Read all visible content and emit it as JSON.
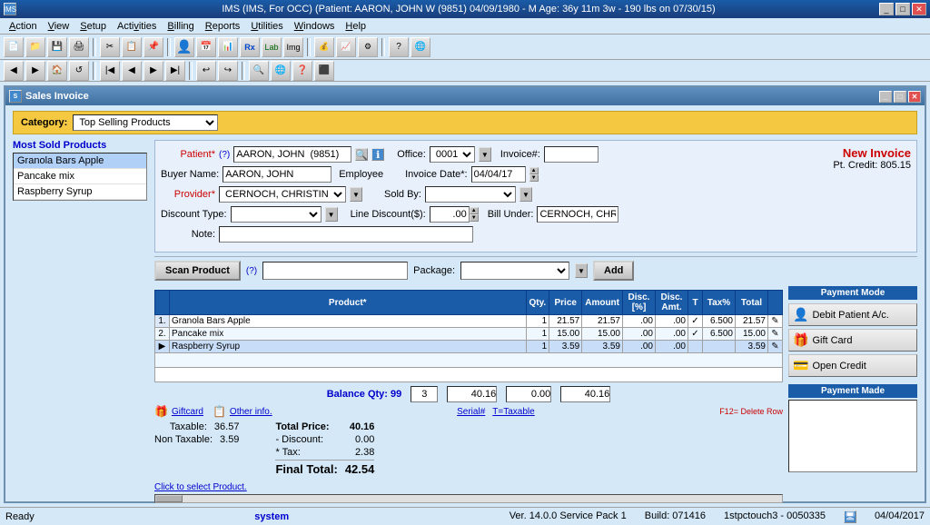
{
  "titlebar": {
    "text": "IMS (IMS, For OCC)    (Patient: AARON, JOHN W (9851) 04/09/1980 - M Age: 36y 11m 3w - 190 lbs on 07/30/15)"
  },
  "menubar": {
    "items": [
      "Action",
      "View",
      "Setup",
      "Activities",
      "Billing",
      "Reports",
      "Utilities",
      "Windows",
      "Help"
    ]
  },
  "window_title": "Sales Invoice",
  "category": {
    "label": "Category:",
    "value": "Top Selling Products"
  },
  "most_sold": {
    "title": "Most Sold Products",
    "items": [
      "Granola Bars Apple",
      "Pancake mix",
      "Raspberry Syrup"
    ]
  },
  "patient_section": {
    "patient_label": "Patient*",
    "patient_hint": "(?)",
    "patient_value": "AARON, JOHN  (9851)",
    "office_label": "Office:",
    "office_value": "0001",
    "invoice_label": "Invoice#:",
    "invoice_value": "",
    "new_invoice": "New Invoice",
    "pt_credit": "Pt. Credit: 805.15",
    "buyer_label": "Buyer Name:",
    "buyer_value": "AARON, JOHN",
    "employee_label": "Employee",
    "invoice_date_label": "Invoice Date*:",
    "invoice_date_value": "04/04/17",
    "provider_label": "Provider*",
    "provider_value": "CERNOCH, CHRISTINE",
    "sold_by_label": "Sold By:",
    "sold_by_value": "",
    "discount_type_label": "Discount Type:",
    "discount_type_value": "",
    "line_discount_label": "Line Discount($):",
    "line_discount_value": ".00",
    "bill_under_label": "Bill Under:",
    "bill_under_value": "CERNOCH, CHRIST",
    "note_label": "Note:"
  },
  "scan_section": {
    "scan_label": "Scan Product",
    "scan_hint": "(?)",
    "package_label": "Package:",
    "add_button": "Add"
  },
  "table": {
    "headers": [
      "Product*",
      "Qty.",
      "Price",
      "Amount",
      "Disc.[%]",
      "Disc. Amt.",
      "T",
      "Tax%",
      "Total",
      ""
    ],
    "rows": [
      {
        "num": "1.",
        "arrow": "",
        "product": "Granola Bars Apple",
        "qty": "1",
        "price": "21.57",
        "amount": "21.57",
        "disc_pct": ".00",
        "disc_amt": ".00",
        "t": "✓",
        "tax_pct": "6.500",
        "total": "21.57",
        "icon": "✎"
      },
      {
        "num": "2.",
        "arrow": "",
        "product": "Pancake mix",
        "qty": "1",
        "price": "15.00",
        "amount": "15.00",
        "disc_pct": ".00",
        "disc_amt": ".00",
        "t": "✓",
        "tax_pct": "6.500",
        "total": "15.00",
        "icon": "✎"
      },
      {
        "num": "",
        "arrow": "▶",
        "product": "Raspberry Syrup",
        "qty": "1",
        "price": "3.59",
        "amount": "3.59",
        "disc_pct": ".00",
        "disc_amt": ".00",
        "t": "",
        "tax_pct": "",
        "total": "3.59",
        "icon": "✎"
      }
    ]
  },
  "balance": {
    "label": "Balance Qty: 99",
    "qty": "3",
    "subtotal": "40.16",
    "discount": "0.00",
    "total": "40.16"
  },
  "footer_links": {
    "giftcard": "Giftcard",
    "other_info": "Other info.",
    "serial": "Serial#",
    "taxable": "T=Taxable",
    "f12_delete": "F12= Delete Row"
  },
  "totals": {
    "taxable_label": "Taxable:",
    "taxable_value": "36.57",
    "non_taxable_label": "Non Taxable:",
    "non_taxable_value": "3.59",
    "total_price_label": "Total Price:",
    "total_price_value": "40.16",
    "discount_label": "- Discount:",
    "discount_value": "0.00",
    "tax_label": "* Tax:",
    "tax_value": "2.38",
    "final_total_label": "Final Total:",
    "final_total_value": "42.54",
    "click_select": "Click to select Product."
  },
  "payment_mode": {
    "title": "Payment Mode",
    "buttons": [
      {
        "label": "Debit Patient A/c.",
        "icon": "person"
      },
      {
        "label": "Gift Card",
        "icon": "gift"
      },
      {
        "label": "Open Credit",
        "icon": ""
      }
    ],
    "payment_made_title": "Payment Made"
  },
  "statusbar": {
    "ready": "Ready",
    "system": "system",
    "ver": "Ver. 14.0.0 Service Pack 1",
    "build": "Build: 071416",
    "instance": "1stpctouch3 - 0050335",
    "date": "04/04/2017"
  }
}
